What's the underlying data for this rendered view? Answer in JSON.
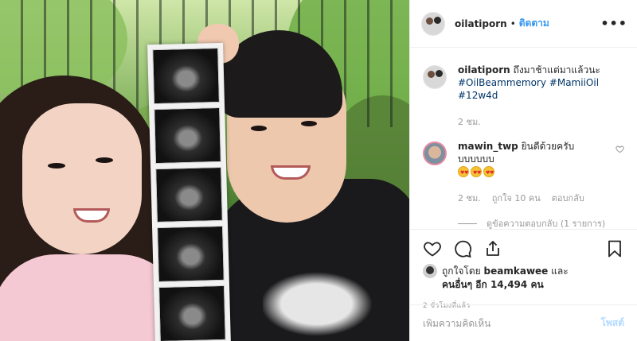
{
  "post": {
    "image_alt": "Couple holding ultrasound scan strip",
    "header": {
      "username": "oilatiporn",
      "separator": "•",
      "follow_label": "ติดตาม",
      "more_icon": "more-horizontal-icon"
    },
    "caption": {
      "username": "oilatiporn",
      "text": "ถึงมาช้าแต่มาแล้วนะ",
      "hashtags": [
        "#OilBeammemory",
        "#MamiiOil",
        "#12w4d"
      ],
      "time": "2 ชม."
    },
    "comments": [
      {
        "username": "mawin_twp",
        "text": "ยินดีด้วยครับบบบบบบ",
        "emoji": "heart-eyes-emoji",
        "time": "2 ชม.",
        "likes": "ถูกใจ 10 คน",
        "reply_label": "ตอบกลับ"
      }
    ],
    "view_replies": "ดูข้อความตอบกลับ (1 รายการ)",
    "likes": {
      "prefix": "ถูกใจโดย",
      "user": "beamkawee",
      "and": "และ",
      "others_prefix": "คนอื่นๆ อีก",
      "count": "14,494",
      "suffix": "คน"
    },
    "timestamp": "2 ชั่วโมงที่แล้ว",
    "add_comment": {
      "placeholder": "เพิ่มความคิดเห็น",
      "post_label": "โพสต์"
    }
  }
}
